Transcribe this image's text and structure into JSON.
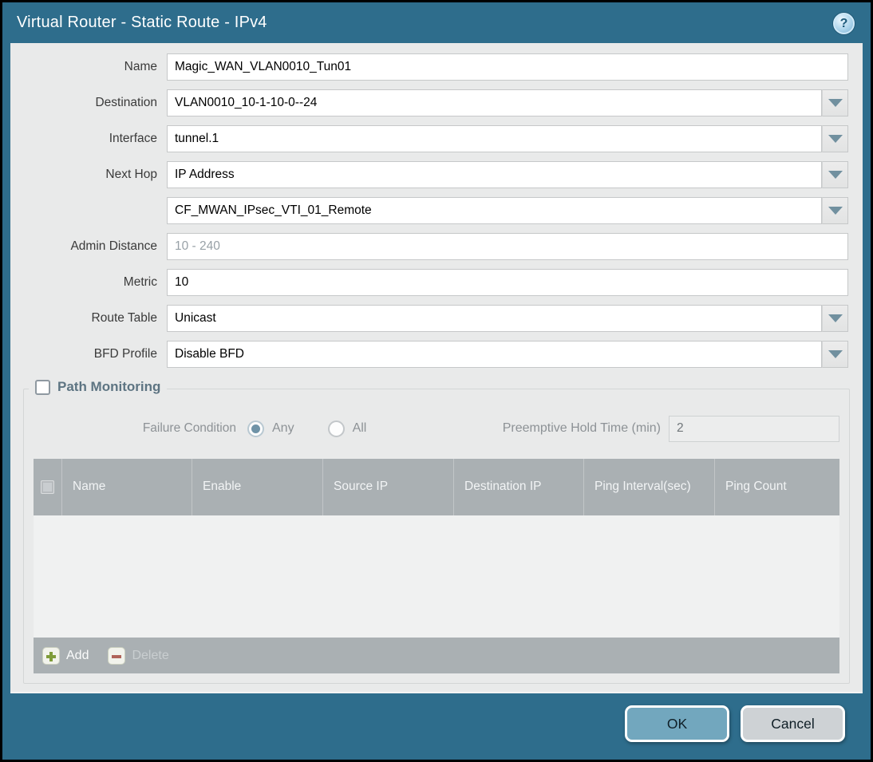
{
  "title_bar": {
    "title": "Virtual Router - Static Route - IPv4",
    "help_glyph": "?"
  },
  "form": {
    "rows": [
      {
        "label": "Name",
        "value": "Magic_WAN_VLAN0010_Tun01",
        "type": "text"
      },
      {
        "label": "Destination",
        "value": "VLAN0010_10-1-10-0--24",
        "type": "dropdown"
      },
      {
        "label": "Interface",
        "value": "tunnel.1",
        "type": "dropdown"
      },
      {
        "label": "Next Hop",
        "value": "IP Address",
        "type": "dropdown"
      },
      {
        "label": "",
        "value": "CF_MWAN_IPsec_VTI_01_Remote",
        "type": "dropdown"
      },
      {
        "label": "Admin Distance",
        "value": "",
        "placeholder": "10 - 240",
        "type": "text"
      },
      {
        "label": "Metric",
        "value": "10",
        "type": "text"
      },
      {
        "label": "Route Table",
        "value": "Unicast",
        "type": "dropdown"
      },
      {
        "label": "BFD Profile",
        "value": "Disable BFD",
        "type": "dropdown"
      }
    ]
  },
  "path_monitoring": {
    "legend": "Path Monitoring",
    "checkbox_checked": false,
    "failure_condition": {
      "label": "Failure Condition",
      "options": [
        {
          "label": "Any",
          "selected": true
        },
        {
          "label": "All",
          "selected": false
        }
      ]
    },
    "preemptive_hold": {
      "label": "Preemptive Hold Time (min)",
      "value": "2"
    },
    "table": {
      "headers": [
        "Name",
        "Enable",
        "Source IP",
        "Destination IP",
        "Ping Interval(sec)",
        "Ping Count"
      ],
      "rows": []
    },
    "footer": {
      "add_label": "Add",
      "delete_label": "Delete"
    }
  },
  "actions": {
    "ok_label": "OK",
    "cancel_label": "Cancel"
  },
  "colors": {
    "frame_teal": "#2e6d8c",
    "content_bg": "#e9eaea",
    "table_header_grey": "#aab0b3",
    "ok_button": "#72a7be",
    "cancel_button": "#ced2d5",
    "add_icon_green": "#7f9c3a",
    "delete_icon_red": "#b0645a",
    "disabled_text": "#8d9296"
  }
}
